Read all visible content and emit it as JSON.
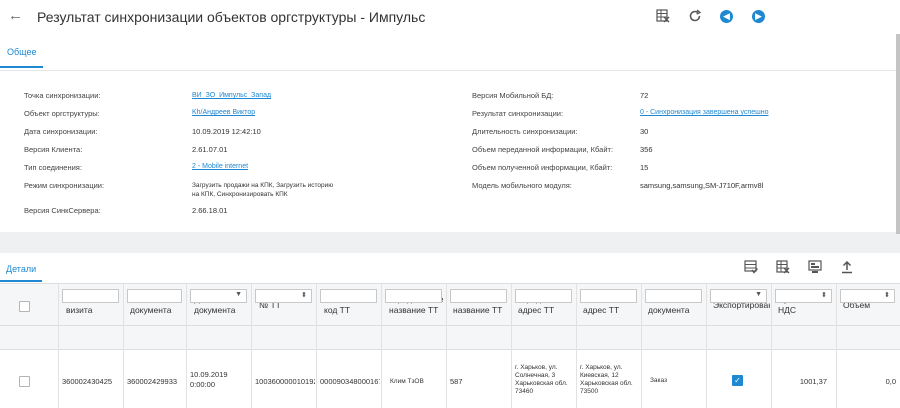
{
  "header": {
    "title": "Результат синхронизации объектов оргструктуры - Импульс",
    "back_icon": "←"
  },
  "tabs": {
    "general": "Общее",
    "details": "Детали"
  },
  "general": {
    "left": [
      {
        "label": "Точка синхронизации:",
        "value": "ВИ_ЗО_Импульс_Запад",
        "type": "link"
      },
      {
        "label": "Объект оргструктуры:",
        "value": "Kh/Андреев Виктор",
        "type": "link"
      },
      {
        "label": "Дата синхронизации:",
        "value": "10.09.2019 12:42:10",
        "type": "text"
      },
      {
        "label": "Версия Клиента:",
        "value": "2.61.07.01",
        "type": "text"
      },
      {
        "label": "Тип соединения:",
        "value": "2 - Mobile internet",
        "type": "link"
      },
      {
        "label": "Режим синхронизации:",
        "value": "Загрузить продажи на КПК, Загрузить историю на КПК, Синхронизировать КПК",
        "type": "multi"
      },
      {
        "label": "Версия СинкСервера:",
        "value": "2.66.18.01",
        "type": "text"
      }
    ],
    "right": [
      {
        "label": "Версия Мобильной БД:",
        "value": "72",
        "type": "text"
      },
      {
        "label": "Результат синхронизации:",
        "value": "0 - Синхронизация завершена успешно",
        "type": "link"
      },
      {
        "label": "Длительность синхронизации:",
        "value": "30",
        "type": "text"
      },
      {
        "label": "Объем переданной информации, Кбайт:",
        "value": "356",
        "type": "text"
      },
      {
        "label": "Объем полученной информации, Кбайт:",
        "value": "15",
        "type": "text"
      },
      {
        "label": "Модель мобильного модуля:",
        "value": "samsung,samsung,SM-J710F,armv8l",
        "type": "text"
      }
    ]
  },
  "details": {
    "columns": [
      "№\nвизита",
      "№\nдокумента",
      "Дата\nдокумента",
      "№ ТТ",
      "Внешний\nкод ТТ",
      "Юридическое\nназвание ТТ",
      "Фактическое\nназвание ТТ",
      "Юридический\nадрес ТТ",
      "Фактический\nадрес ТТ",
      "Тип\nдокумента",
      "Экспортирован",
      "Сумма с\nНДС",
      "Объем"
    ],
    "row": {
      "visit": "360002430425",
      "doc": "360002429933",
      "date": "10.09.2019\n0:00:00",
      "tt": "100360000010192",
      "ext_code": "000090348000167",
      "legal_name": "Клим ТзОВ",
      "fact_name": "587",
      "legal_addr": "г. Харьков, ул. Солнечная, 3 Харьковская обл. 73460",
      "fact_addr": "г. Харьков, ул. Киевская, 12 Харьковская обл. 73500",
      "doc_type": "Заказ",
      "exported": true,
      "sum": "1001,37",
      "volume": "0,0"
    }
  },
  "colors": {
    "accent": "#1e88d2"
  }
}
